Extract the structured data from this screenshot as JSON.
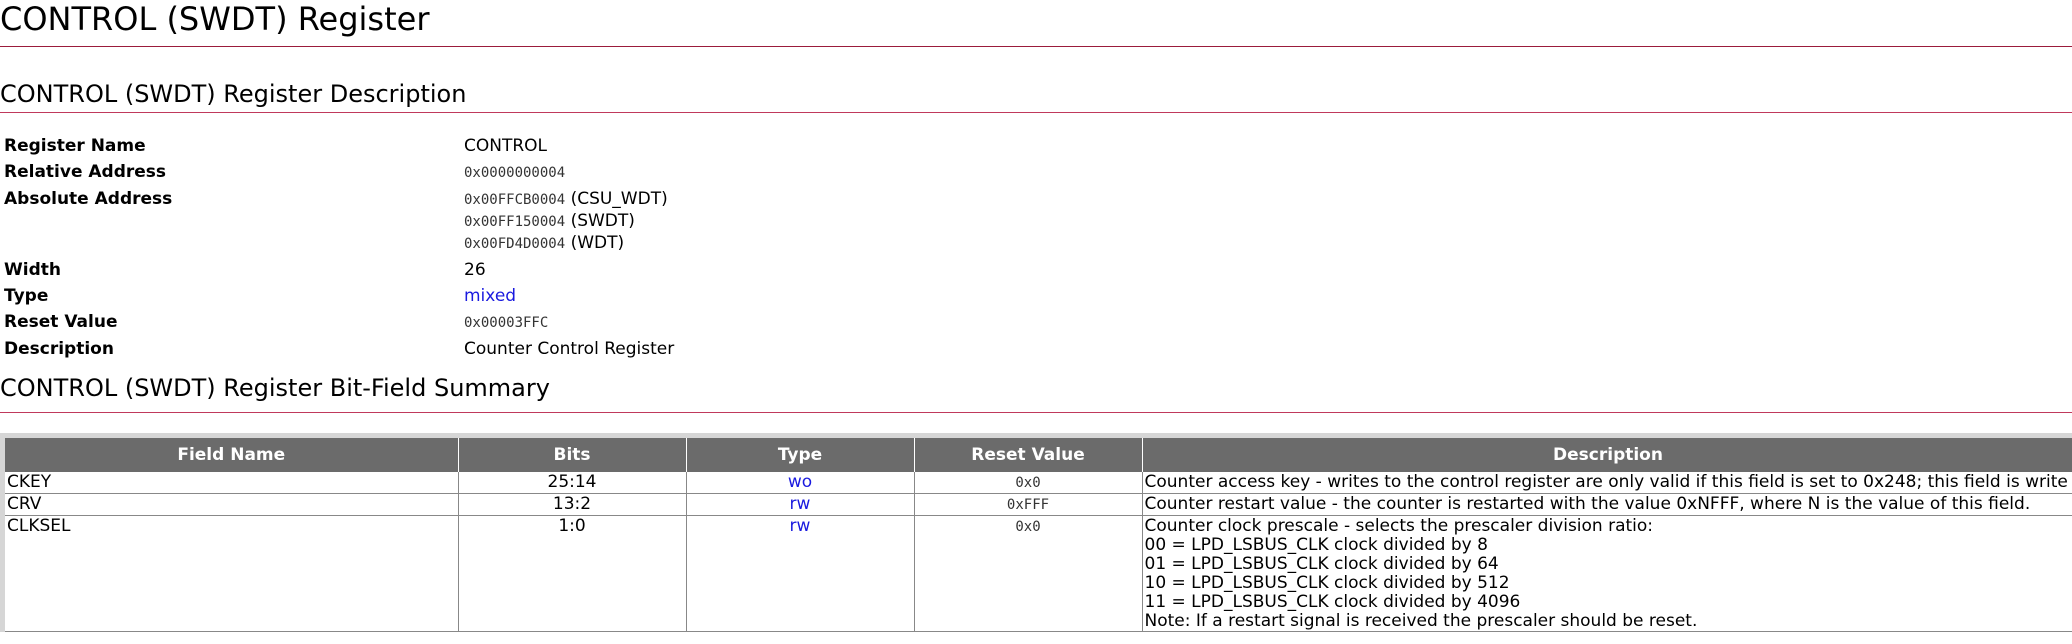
{
  "page_title": "CONTROL (SWDT) Register",
  "description_section": {
    "heading": "CONTROL (SWDT) Register Description",
    "rows": {
      "register_name": {
        "label": "Register Name",
        "value": "CONTROL"
      },
      "relative_address": {
        "label": "Relative Address",
        "value": "0x0000000004"
      },
      "absolute_address": {
        "label": "Absolute Address",
        "values": [
          {
            "addr": "0x00FFCB0004",
            "name": "(CSU_WDT)"
          },
          {
            "addr": "0x00FF150004",
            "name": "(SWDT)"
          },
          {
            "addr": "0x00FD4D0004",
            "name": "(WDT)"
          }
        ]
      },
      "width": {
        "label": "Width",
        "value": "26"
      },
      "type": {
        "label": "Type",
        "value": "mixed"
      },
      "reset_value": {
        "label": "Reset Value",
        "value": "0x00003FFC"
      },
      "description": {
        "label": "Description",
        "value": "Counter Control Register"
      }
    }
  },
  "summary_section": {
    "heading": "CONTROL (SWDT) Register Bit-Field Summary",
    "columns": [
      "Field Name",
      "Bits",
      "Type",
      "Reset Value",
      "Description"
    ],
    "fields": [
      {
        "name": "CKEY",
        "bits": "25:14",
        "type": "wo",
        "reset": "0x0",
        "description": [
          "Counter access key - writes to the control register are only valid if this field is set to 0x248; this field is write only."
        ]
      },
      {
        "name": "CRV",
        "bits": "13:2",
        "type": "rw",
        "reset": "0xFFF",
        "description": [
          "Counter restart value - the counter is restarted with the value 0xNFFF, where N is the value of this field."
        ]
      },
      {
        "name": "CLKSEL",
        "bits": "1:0",
        "type": "rw",
        "reset": "0x0",
        "description": [
          "Counter clock prescale - selects the prescaler division ratio:",
          "00 = LPD_LSBUS_CLK clock divided by 8",
          "01 = LPD_LSBUS_CLK clock divided by 64",
          "10 = LPD_LSBUS_CLK clock divided by 512",
          "11 = LPD_LSBUS_CLK clock divided by 4096",
          "Note: If a restart signal is received the prescaler should be reset."
        ]
      }
    ]
  }
}
